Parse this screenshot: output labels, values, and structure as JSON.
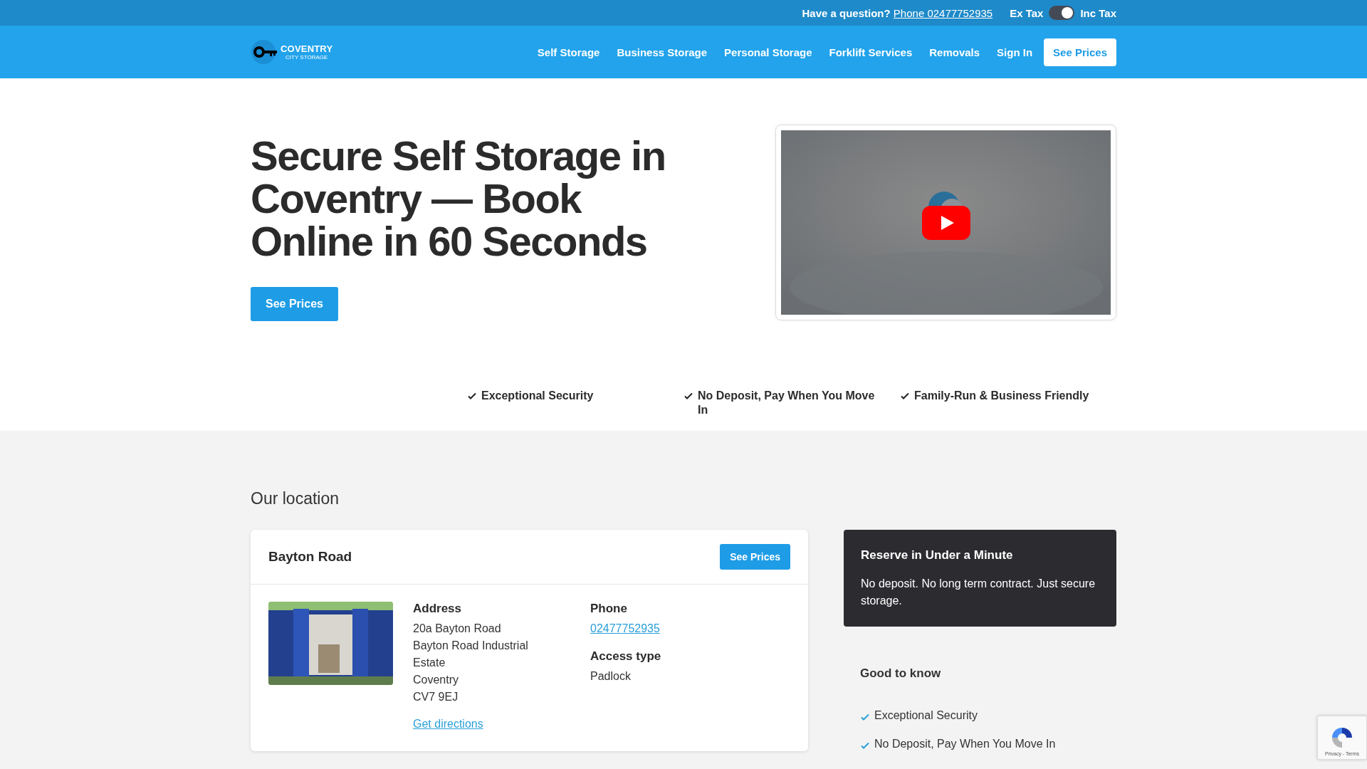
{
  "top_bar": {
    "question": "Have a question?",
    "phone_link": "Phone 02477752935",
    "tax_toggle": {
      "off_label": "Ex Tax",
      "on_label": "Inc Tax",
      "on": true
    }
  },
  "nav": {
    "logo": {
      "name": "COVENTRY",
      "tagline": "CITY STORAGE"
    },
    "items": [
      "Self Storage",
      "Business Storage",
      "Personal Storage",
      "Forklift Services",
      "Removals",
      "Sign In"
    ],
    "cta": "See Prices"
  },
  "hero": {
    "title": "Secure Self Storage in Coventry — Book Online in 60 Seconds",
    "cta": "See Prices"
  },
  "features": [
    "Exceptional Security",
    "No Deposit, Pay When You Move In",
    "Family-Run & Business Friendly"
  ],
  "location_section": {
    "heading": "Our location",
    "card": {
      "name": "Bayton Road",
      "cta": "See Prices",
      "address_label": "Address",
      "address_lines": [
        "20a Bayton Road",
        "Bayton Road Industrial Estate",
        "Coventry",
        "CV7 9EJ"
      ],
      "directions_link": "Get directions",
      "phone_label": "Phone",
      "phone": "02477752935",
      "access_label": "Access type",
      "access": "Padlock"
    }
  },
  "reserve_card": {
    "title": "Reserve in Under a Minute",
    "text": "No deposit. No long term contract. Just secure storage."
  },
  "good_to_know": {
    "heading": "Good to know",
    "items": [
      "Exceptional Security",
      "No Deposit, Pay When You Move In"
    ]
  },
  "recaptcha": {
    "links": "Privacy - Terms"
  }
}
